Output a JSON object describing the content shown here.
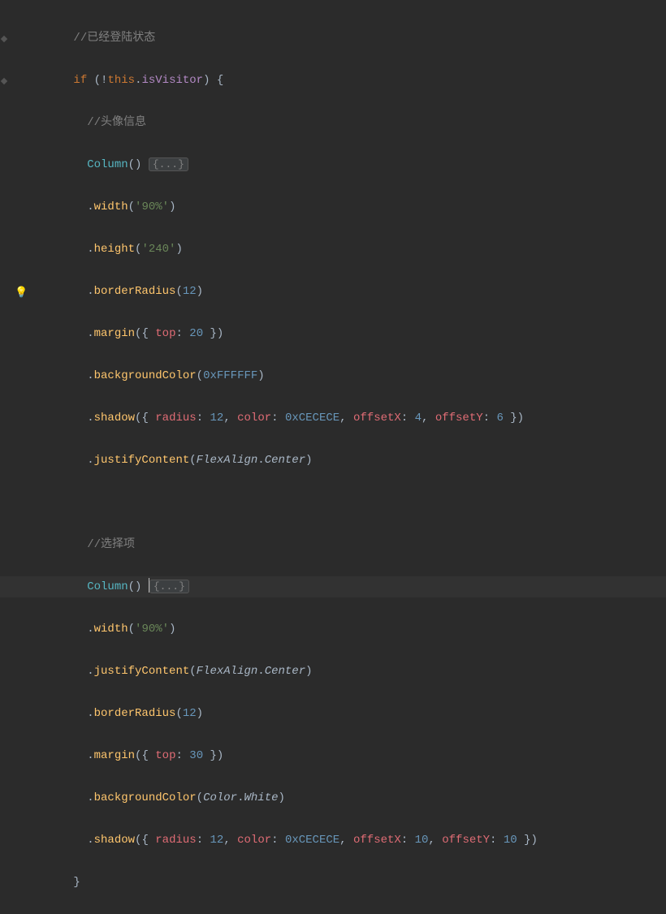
{
  "editor": {
    "comment_logged_in": "//已经登陆状态",
    "if_kw": "if",
    "this_kw": "this",
    "visitor_prop": "isVisitor",
    "comment_avatar": "//头像信息",
    "column_call": "Column",
    "folded": "{...}",
    "width_m": "width",
    "width_arg": "'90%'",
    "height_m": "height",
    "height_arg": "'240'",
    "border_m": "borderRadius",
    "border_arg": "12",
    "margin_m": "margin",
    "margin_top1": "top",
    "margin_val1": "20",
    "bg_m": "backgroundColor",
    "bg_arg1": "0xFFFFFF",
    "shadow_m": "shadow",
    "radius_k": "radius",
    "radius_v": "12",
    "color_k": "color",
    "color_v": "0xCECECE",
    "ox_k": "offsetX",
    "ox_v1": "4",
    "oy_k": "offsetY",
    "oy_v1": "6",
    "justify_m": "justifyContent",
    "flex_enum": "FlexAlign",
    "center_enum": "Center",
    "comment_options": "//选择项",
    "margin_val2": "30",
    "color_enum": "Color",
    "white_enum": "White",
    "ox_v2": "10",
    "oy_v2": "10"
  }
}
